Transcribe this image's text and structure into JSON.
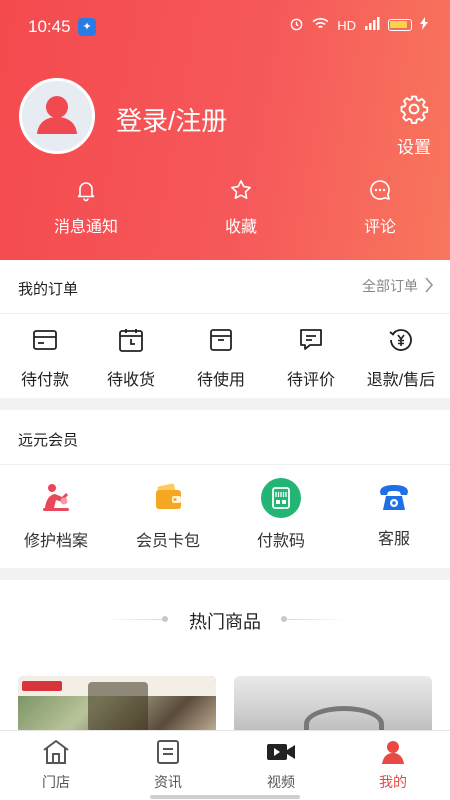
{
  "status_bar": {
    "time": "10:45",
    "network_label": "HD"
  },
  "profile": {
    "login_label": "登录/注册",
    "settings_label": "设置"
  },
  "quick_actions": [
    {
      "label": "消息通知",
      "icon": "bell-icon"
    },
    {
      "label": "收藏",
      "icon": "star-icon"
    },
    {
      "label": "评论",
      "icon": "comment-icon"
    }
  ],
  "orders": {
    "title": "我的订单",
    "all_label": "全部订单",
    "items": [
      {
        "label": "待付款",
        "icon": "wallet-card-icon"
      },
      {
        "label": "待收货",
        "icon": "calendar-icon"
      },
      {
        "label": "待使用",
        "icon": "box-icon"
      },
      {
        "label": "待评价",
        "icon": "comment-edit-icon"
      },
      {
        "label": "退款/售后",
        "icon": "refund-yen-icon"
      }
    ]
  },
  "membership": {
    "title": "远元会员",
    "items": [
      {
        "label": "修护档案",
        "icon": "massage-icon",
        "color": "#e9475a"
      },
      {
        "label": "会员卡包",
        "icon": "card-wallet-icon",
        "color": "#f5a623"
      },
      {
        "label": "付款码",
        "icon": "payment-code-icon",
        "color": "#22b573"
      },
      {
        "label": "客服",
        "icon": "telephone-icon",
        "color": "#1f6fe5"
      }
    ]
  },
  "hot_products": {
    "title": "热门商品"
  },
  "tabbar": {
    "active_color": "#e84a43",
    "items": [
      {
        "label": "门店",
        "icon": "store-icon"
      },
      {
        "label": "资讯",
        "icon": "news-icon"
      },
      {
        "label": "视频",
        "icon": "video-icon"
      },
      {
        "label": "我的",
        "icon": "user-icon"
      }
    ]
  }
}
